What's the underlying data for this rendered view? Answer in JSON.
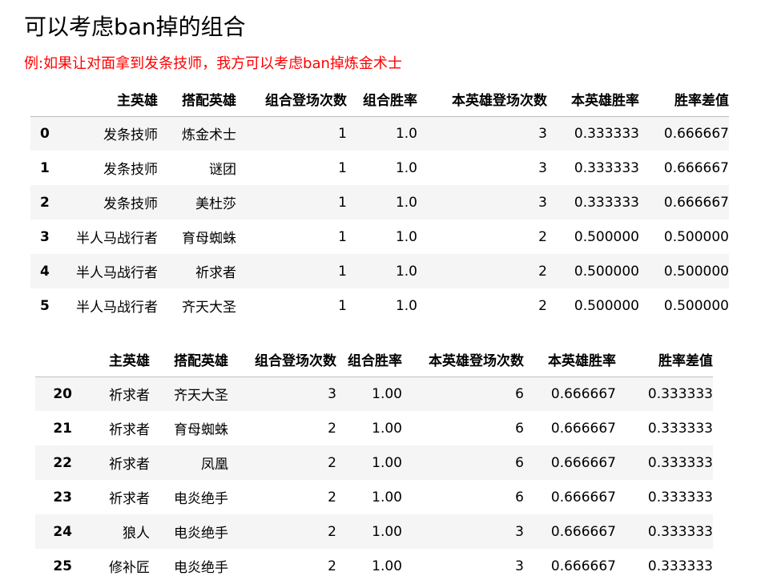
{
  "title": "可以考虑ban掉的组合",
  "note": "例:如果让对面拿到发条技师，我方可以考虑ban掉炼金术士",
  "table1": {
    "columns": [
      "",
      "主英雄",
      "搭配英雄",
      "组合登场次数",
      "组合胜率",
      "本英雄登场次数",
      "本英雄胜率",
      "胜率差值"
    ],
    "rows": [
      [
        "0",
        "发条技师",
        "炼金术士",
        "1",
        "1.0",
        "3",
        "0.333333",
        "0.666667"
      ],
      [
        "1",
        "发条技师",
        "谜团",
        "1",
        "1.0",
        "3",
        "0.333333",
        "0.666667"
      ],
      [
        "2",
        "发条技师",
        "美杜莎",
        "1",
        "1.0",
        "3",
        "0.333333",
        "0.666667"
      ],
      [
        "3",
        "半人马战行者",
        "育母蜘蛛",
        "1",
        "1.0",
        "2",
        "0.500000",
        "0.500000"
      ],
      [
        "4",
        "半人马战行者",
        "祈求者",
        "1",
        "1.0",
        "2",
        "0.500000",
        "0.500000"
      ],
      [
        "5",
        "半人马战行者",
        "齐天大圣",
        "1",
        "1.0",
        "2",
        "0.500000",
        "0.500000"
      ]
    ]
  },
  "table2": {
    "columns": [
      "",
      "主英雄",
      "搭配英雄",
      "组合登场次数",
      "组合胜率",
      "本英雄登场次数",
      "本英雄胜率",
      "胜率差值"
    ],
    "rows": [
      [
        "20",
        "祈求者",
        "齐天大圣",
        "3",
        "1.00",
        "6",
        "0.666667",
        "0.333333"
      ],
      [
        "21",
        "祈求者",
        "育母蜘蛛",
        "2",
        "1.00",
        "6",
        "0.666667",
        "0.333333"
      ],
      [
        "22",
        "祈求者",
        "凤凰",
        "2",
        "1.00",
        "6",
        "0.666667",
        "0.333333"
      ],
      [
        "23",
        "祈求者",
        "电炎绝手",
        "2",
        "1.00",
        "6",
        "0.666667",
        "0.333333"
      ],
      [
        "24",
        "狼人",
        "电炎绝手",
        "2",
        "1.00",
        "3",
        "0.666667",
        "0.333333"
      ],
      [
        "25",
        "修补匠",
        "电炎绝手",
        "2",
        "1.00",
        "3",
        "0.666667",
        "0.333333"
      ]
    ]
  }
}
